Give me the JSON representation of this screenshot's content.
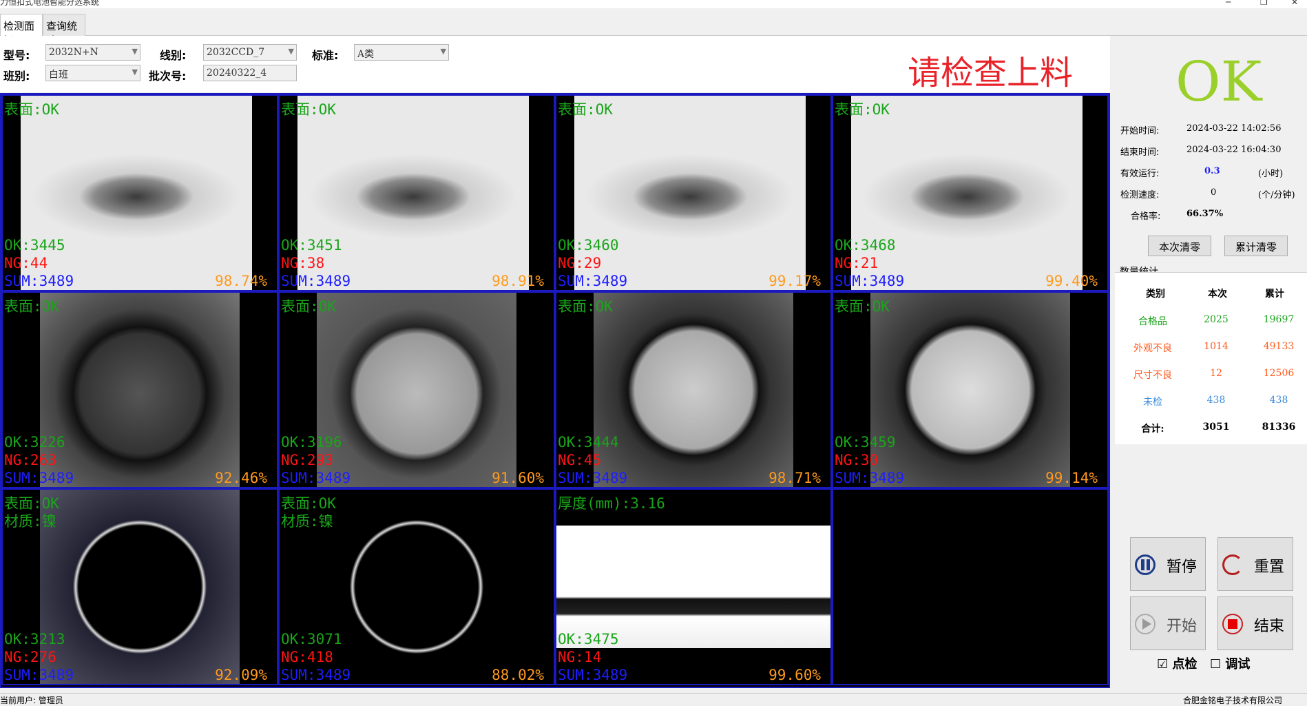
{
  "window": {
    "title": "力恒扣式电池智能分选系统"
  },
  "tabs": [
    {
      "label": "检测面板"
    },
    {
      "label": "查询统计"
    }
  ],
  "form": {
    "model_label": "型号:",
    "model_value": "2032N+N",
    "line_label": "线别:",
    "line_value": "2032CCD_7",
    "standard_label": "标准:",
    "standard_value": "A类",
    "shift_label": "班别:",
    "shift_value": "白班",
    "batch_label": "批次号:",
    "batch_value": "20240322_4"
  },
  "prompt_text": "请检查上料",
  "result_text": "OK",
  "cells": [
    {
      "l1": "表面:OK",
      "ok": "OK:3445",
      "ng": "NG:44",
      "sum": "SUM:3489",
      "pct": "98.74%"
    },
    {
      "l1": "表面:OK",
      "ok": "OK:3451",
      "ng": "NG:38",
      "sum": "SUM:3489",
      "pct": "98.91%"
    },
    {
      "l1": "表面:OK",
      "ok": "OK:3460",
      "ng": "NG:29",
      "sum": "SUM:3489",
      "pct": "99.17%"
    },
    {
      "l1": "表面:OK",
      "ok": "OK:3468",
      "ng": "NG:21",
      "sum": "SUM:3489",
      "pct": "99.40%"
    },
    {
      "l1": "表面:OK",
      "ok": "OK:3226",
      "ng": "NG:263",
      "sum": "SUM:3489",
      "pct": "92.46%"
    },
    {
      "l1": "表面:OK",
      "ok": "OK:3196",
      "ng": "NG:293",
      "sum": "SUM:3489",
      "pct": "91.60%"
    },
    {
      "l1": "表面:OK",
      "ok": "OK:3444",
      "ng": "NG:45",
      "sum": "SUM:3489",
      "pct": "98.71%"
    },
    {
      "l1": "表面:OK",
      "ok": "OK:3459",
      "ng": "NG:30",
      "sum": "SUM:3489",
      "pct": "99.14%"
    },
    {
      "l1": "表面:OK",
      "l2": "材质:镍",
      "ok": "OK:3213",
      "ng": "NG:276",
      "sum": "SUM:3489",
      "pct": "92.09%"
    },
    {
      "l1": "表面:OK",
      "l2": "材质:镍",
      "ok": "OK:3071",
      "ng": "NG:418",
      "sum": "SUM:3489",
      "pct": "88.02%"
    },
    {
      "l1": "厚度(mm):3.16",
      "ok": "OK:3475",
      "ng": "NG:14",
      "sum": "SUM:3489",
      "pct": "99.60%"
    }
  ],
  "info": {
    "start_label": "开始时间:",
    "start_value": "2024-03-22 14:02:56",
    "end_label": "结束时间:",
    "end_value": "2024-03-22 16:04:30",
    "run_label": "有效运行:",
    "run_value": "0.3",
    "run_unit": "(小时)",
    "speed_label": "检测速度:",
    "speed_value": "0",
    "speed_unit": "(个/分钟)",
    "rate_label": "合格率:",
    "rate_value": "66.37%"
  },
  "buttons": {
    "clear_current": "本次清零",
    "clear_total": "累计清零",
    "pause": "暂停",
    "reset": "重置",
    "start": "开始",
    "stop": "结束"
  },
  "stats": {
    "title": "数量统计",
    "headers": [
      "类别",
      "本次",
      "累计"
    ],
    "rows": [
      {
        "name": "合格品",
        "cur": "2025",
        "total": "19697",
        "color": "#1aa51a"
      },
      {
        "name": "外观不良",
        "cur": "1014",
        "total": "49133",
        "color": "#ff5a1e"
      },
      {
        "name": "尺寸不良",
        "cur": "12",
        "total": "12506",
        "color": "#ff5a1e"
      },
      {
        "name": "未检",
        "cur": "438",
        "total": "438",
        "color": "#3c8cdc"
      },
      {
        "name": "合计:",
        "cur": "3051",
        "total": "81336",
        "color": "#000000"
      }
    ]
  },
  "checks": {
    "spot_label": "点检",
    "debug_label": "调试"
  },
  "status": {
    "user": "当前用户: 管理员",
    "company": "合肥金铭电子技术有限公司"
  }
}
